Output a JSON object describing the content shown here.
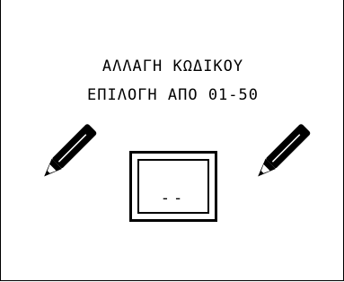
{
  "screen": {
    "title_line1": "ΑΛΛΑΓΗ ΚΩΔΙΚΟΥ",
    "title_line2": "ΕΠΙΛΟΓΗ ΑΠΟ 01-50"
  },
  "code_entry": {
    "value": "--"
  },
  "icons": {
    "left": "pencil-icon",
    "right": "pencil-icon"
  },
  "colors": {
    "background": "#ffffff",
    "foreground": "#000000"
  }
}
